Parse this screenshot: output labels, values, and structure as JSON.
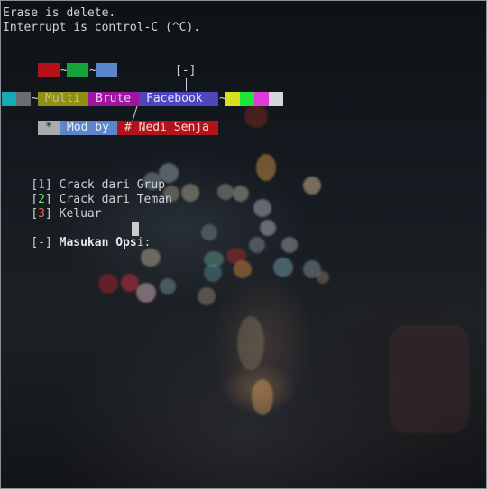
{
  "terminal": {
    "line_erase": "Erase is delete.",
    "line_interrupt": "Interrupt is control-C (^C).",
    "tilde": "~",
    "indicator": "[-]",
    "banner": {
      "word1": "Multi",
      "word2": "Brute",
      "word3": "Facebook"
    },
    "mod": {
      "star": "*",
      "label": "Mod by",
      "author": "# Nedi Senja"
    },
    "menu": [
      {
        "open": "[",
        "num": "1",
        "close": "]",
        "label": " Crack dari Grup",
        "num_color": "#7f8cff"
      },
      {
        "open": "[",
        "num": "2",
        "close": "]",
        "label": " Crack dari Teman",
        "num_color": "#6fe36f"
      },
      {
        "open": "[",
        "num": "3",
        "close": "]",
        "label": " Keluar",
        "num_color": "#ff5a5a"
      }
    ],
    "prompt": {
      "prefix": "[-] ",
      "label_bold": "Masukan Ops",
      "label_rest": "i: "
    }
  },
  "colors": {
    "accent_red": "#b3121a",
    "accent_green": "#16a53a",
    "accent_blue": "#5b86c9",
    "chip_olive": "#8f8f14",
    "chip_magenta": "#a0179f",
    "chip_indigo": "#4d46bd"
  }
}
